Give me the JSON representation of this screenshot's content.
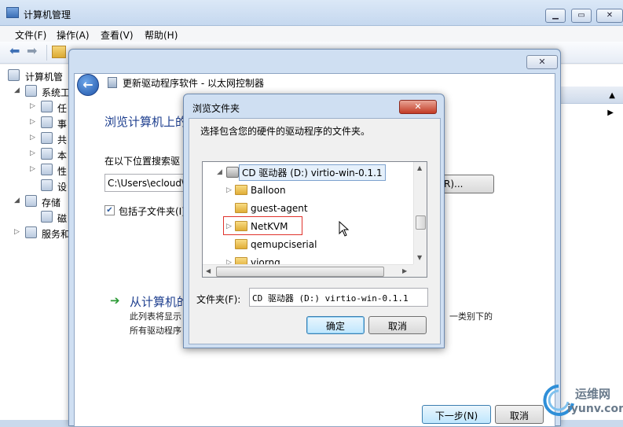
{
  "mmc": {
    "title": "计算机管理",
    "menu": [
      "文件(F)",
      "操作(A)",
      "查看(V)",
      "帮助(H)"
    ],
    "tree": [
      {
        "label": "计算机管",
        "icon": "computer-management-icon"
      },
      {
        "label": "系统工",
        "icon": "system-tools-icon"
      },
      {
        "label": "任",
        "icon": "task-scheduler-icon"
      },
      {
        "label": "事",
        "icon": "event-viewer-icon"
      },
      {
        "label": "共",
        "icon": "shared-folders-icon"
      },
      {
        "label": "本",
        "icon": "local-users-icon"
      },
      {
        "label": "性",
        "icon": "performance-icon"
      },
      {
        "label": "设",
        "icon": "device-manager-icon"
      },
      {
        "label": "存储",
        "icon": "storage-icon"
      },
      {
        "label": "磁",
        "icon": "disk-management-icon"
      },
      {
        "label": "服务和",
        "icon": "services-icon"
      }
    ]
  },
  "wizard": {
    "title": "更新驱动程序软件 - 以太网控制器",
    "heading": "浏览计算机上的",
    "search_label": "在以下位置搜索驱",
    "path_value": "C:\\Users\\ecloud\\",
    "browse_label": "R)...",
    "include_subfolders": "包括子文件夹(I)",
    "option_title": "从计算机的",
    "option_desc_1": "此列表将显示",
    "option_desc_1_tail": "一类别下的",
    "option_desc_2": "所有驱动程序",
    "next_label": "下一步(N)",
    "cancel_label": "取消"
  },
  "browse_dialog": {
    "title": "浏览文件夹",
    "prompt": "选择包含您的硬件的驱动程序的文件夹。",
    "tree": [
      {
        "label": "CD 驱动器 (D:) virtio-win-0.1.1",
        "kind": "drive",
        "selected": true
      },
      {
        "label": "Balloon",
        "kind": "folder",
        "expandable": true
      },
      {
        "label": "guest-agent",
        "kind": "folder",
        "expandable": false
      },
      {
        "label": "NetKVM",
        "kind": "folder",
        "expandable": true
      },
      {
        "label": "qemupciserial",
        "kind": "folder",
        "expandable": false
      },
      {
        "label": "viorng",
        "kind": "folder",
        "expandable": true
      }
    ],
    "folder_label": "文件夹(F):",
    "folder_value": "CD 驱动器 (D:) virtio-win-0.1.1",
    "ok_label": "确定",
    "cancel_label": "取消"
  },
  "watermark": {
    "line1": "运维网",
    "line2": "iyunv.com"
  },
  "colors": {
    "accent_blue": "#1e3f8f",
    "highlight_red": "#e0322c",
    "folder_yellow": "#e0ad36"
  }
}
